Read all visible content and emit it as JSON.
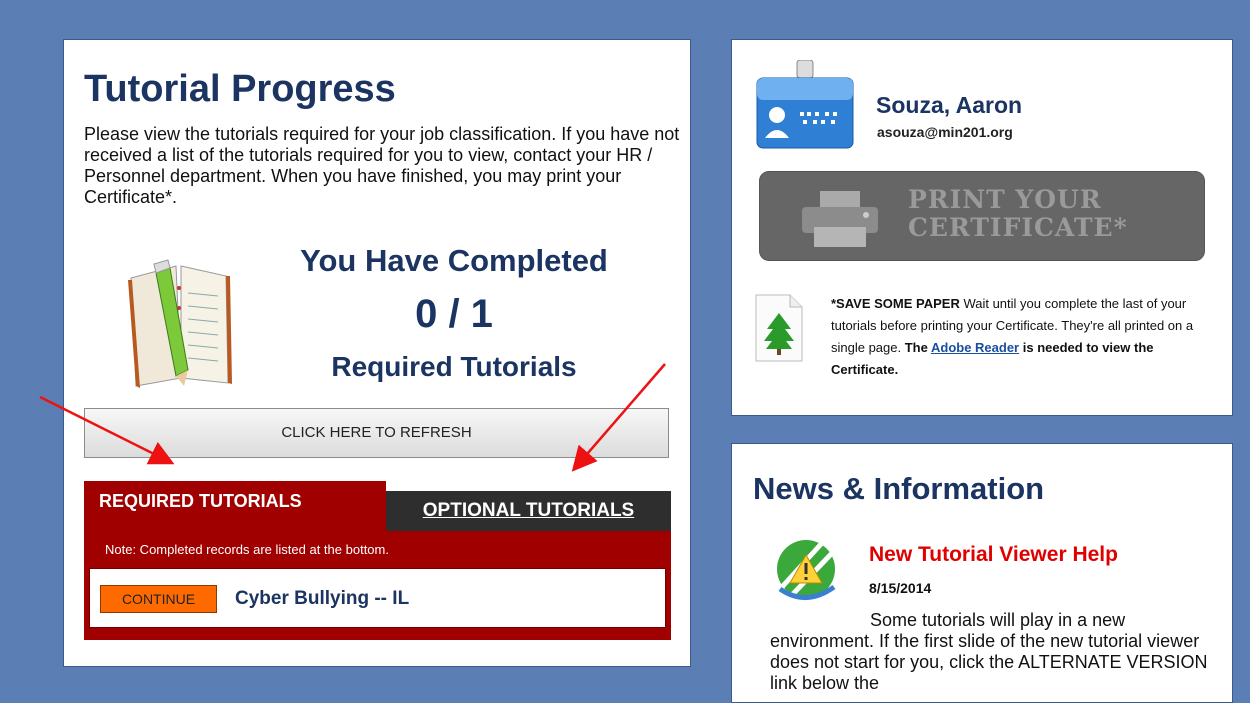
{
  "progress": {
    "title": "Tutorial Progress",
    "intro": "Please view the tutorials required for your job classification. If you have not received a list of the tutorials required for you to view, contact your HR / Personnel department. When you have finished, you may print your Certificate*.",
    "completed_heading": "You Have Completed",
    "completed_count": "0 / 1",
    "completed_sub": "Required Tutorials",
    "refresh_label": "CLICK HERE TO REFRESH"
  },
  "tabs": {
    "required_label": "REQUIRED TUTORIALS",
    "optional_label": "OPTIONAL TUTORIALS",
    "note": "Note: Completed records are listed at the bottom.",
    "items": [
      {
        "button": "CONTINUE",
        "title": "Cyber Bullying -- IL"
      }
    ]
  },
  "user": {
    "name": "Souza, Aaron",
    "email": "asouza@min201.org"
  },
  "print": {
    "line1": "PRINT YOUR",
    "line2": "CERTIFICATE*"
  },
  "save_note": {
    "bold_lead": "*SAVE SOME PAPER",
    "text1": " Wait until you complete the last of your tutorials before printing your Certificate. They're all printed on a single page. ",
    "bold_the": "The ",
    "link": "Adobe Reader",
    "bold_tail": " is needed to view the Certificate."
  },
  "news": {
    "title": "News & Information",
    "item_title": "New Tutorial Viewer Help",
    "item_date": "8/15/2014",
    "item_body": "Some tutorials will play in a new environment. If the first slide of the new tutorial viewer does not start for you, click the ALTERNATE VERSION link below the"
  },
  "colors": {
    "background": "#5b7fb5",
    "navy": "#1b3461",
    "tab_red": "#a00000",
    "tab_dark": "#2e2e2e",
    "continue_orange": "#ff6a00",
    "news_red": "#e00000"
  },
  "icons": [
    "book-icon",
    "pencil-icon",
    "id-badge-icon",
    "printer-icon",
    "tree-document-icon",
    "warning-icon",
    "arrow-annotation"
  ]
}
